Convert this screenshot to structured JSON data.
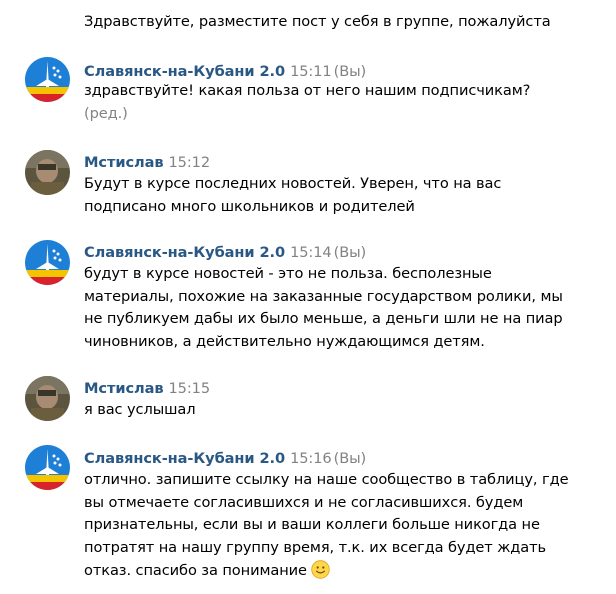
{
  "top_text": "Здравствуйте, разместите пост у себя в группе, пожалуйста",
  "messages": [
    {
      "author": "Славянск-на-Кубани 2.0",
      "time": "15:11",
      "you": "(Вы)",
      "avatar": "city-logo",
      "lines": [
        "здравствуйте! какая польза от него нашим подписчикам?"
      ],
      "edited": "(ред.)"
    },
    {
      "author": "Мстислав",
      "time": "15:12",
      "avatar": "person-photo",
      "lines": [
        "Будут в курсе последних новостей. Уверен, что на вас",
        "подписано много школьников и родителей"
      ]
    },
    {
      "author": "Славянск-на-Кубани 2.0",
      "time": "15:14",
      "you": "(Вы)",
      "avatar": "city-logo",
      "lines": [
        "будут в курсе новостей - это не польза. бесполезные",
        "материалы, похожие на заказанные государством ролики, мы",
        "не публикуем дабы их было меньше, а деньги шли не на пиар",
        "чиновников, а действительно нуждающимся детям."
      ]
    },
    {
      "author": "Мстислав",
      "time": "15:15",
      "avatar": "person-photo",
      "lines": [
        "я вас услышал"
      ]
    },
    {
      "author": "Славянск-на-Кубани 2.0",
      "time": "15:16",
      "you": "(Вы)",
      "avatar": "city-logo",
      "lines": [
        "отлично. запишите ссылку на наше сообщество в таблицу, где",
        "вы отмечаете согласившихся и не согласившихся. будем",
        "признательны, если вы и ваши коллеги больше никогда не",
        "потратят на нашу группу время, т.к. их всегда будет ждать",
        "отказ. спасибо за понимание"
      ],
      "emoji": "smile-emoji"
    }
  ],
  "colors": {
    "author": "#2a5885",
    "meta": "#828282",
    "text": "#000000",
    "logo_blue": "#1d7fd6",
    "logo_yellow": "#f4c400",
    "logo_red": "#d8232a"
  }
}
